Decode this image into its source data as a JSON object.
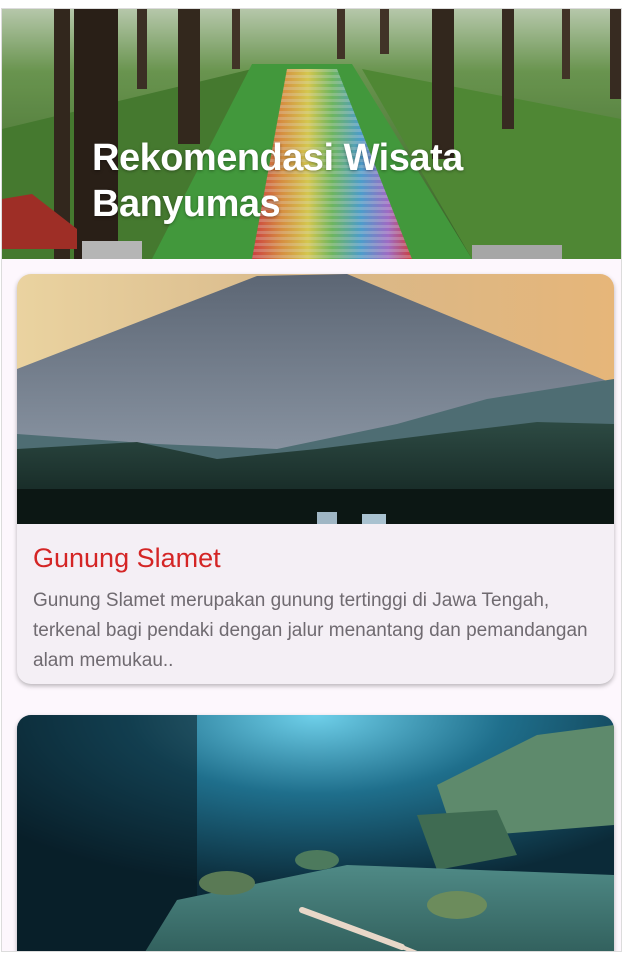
{
  "header": {
    "title": "Rekomendasi Wisata\nBanyumas"
  },
  "destinations": [
    {
      "title": "Gunung Slamet",
      "description": "Gunung Slamet merupakan gunung tertinggi di Jawa Tengah, terkenal bagi pendaki dengan jalur menantang dan pemandangan alam memukau.."
    },
    {
      "title": "",
      "description": ""
    }
  ],
  "colors": {
    "title_accent": "#d42525",
    "description_text": "#6f6a70",
    "card_background": "#f4eff5",
    "page_background": "#fdf7fd"
  }
}
